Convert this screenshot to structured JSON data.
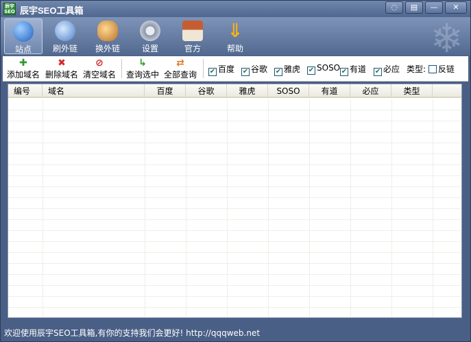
{
  "window": {
    "title": "辰宇SEO工具箱",
    "app_icon_text": "辰宇 SEO"
  },
  "title_buttons": [
    {
      "name": "skin-button",
      "glyph": "◌"
    },
    {
      "name": "menu-button",
      "glyph": "▤"
    },
    {
      "name": "minimize-button",
      "glyph": "—"
    },
    {
      "name": "close-button",
      "glyph": "✕"
    }
  ],
  "toolbar": {
    "items": [
      {
        "label": "站点",
        "icon": "globe-icon",
        "color": "#2f78d6",
        "active": true
      },
      {
        "label": "刷外链",
        "icon": "satellite-icon",
        "color": "#6fa3e8",
        "active": false
      },
      {
        "label": "换外链",
        "icon": "users-icon",
        "color": "#e1a64a",
        "active": false
      },
      {
        "label": "设置",
        "icon": "gear-icon",
        "color": "#9aa6b8",
        "active": false
      },
      {
        "label": "官方",
        "icon": "house-icon",
        "color": "#c86b3c",
        "active": false
      },
      {
        "label": "帮助",
        "icon": "help-arrow-icon",
        "color": "#f2b21b",
        "active": false
      }
    ]
  },
  "actions": {
    "add": {
      "label": "添加域名",
      "icon": "plus-icon",
      "glyph": "✚",
      "color": "#2c9a2c"
    },
    "delete": {
      "label": "删除域名",
      "icon": "delete-x-icon",
      "glyph": "✖",
      "color": "#d22a2a"
    },
    "clear": {
      "label": "清空域名",
      "icon": "clear-icon",
      "glyph": "⊘",
      "color": "#d22a2a"
    },
    "query_selected": {
      "label": "查询选中",
      "icon": "arrow-right-icon",
      "glyph": "↳",
      "color": "#2c9a2c"
    },
    "query_all": {
      "label": "全部查询",
      "icon": "refresh-icon",
      "glyph": "⇄",
      "color": "#e0782c"
    }
  },
  "engines": [
    {
      "label": "百度",
      "checked": true
    },
    {
      "label": "谷歌",
      "checked": true
    },
    {
      "label": "雅虎",
      "checked": true
    },
    {
      "label": "SOSO",
      "checked": true
    },
    {
      "label": "有道",
      "checked": true
    },
    {
      "label": "必应",
      "checked": true
    }
  ],
  "type_label": "类型:",
  "backlink": {
    "label": "反链",
    "checked": false
  },
  "table": {
    "columns": [
      "编号",
      "域名",
      "百度",
      "谷歌",
      "雅虎",
      "SOSO",
      "有道",
      "必应",
      "类型"
    ]
  },
  "status": {
    "text": "欢迎使用辰宇SEO工具箱,有你的支持我们会更好! http://qqqweb.net"
  }
}
